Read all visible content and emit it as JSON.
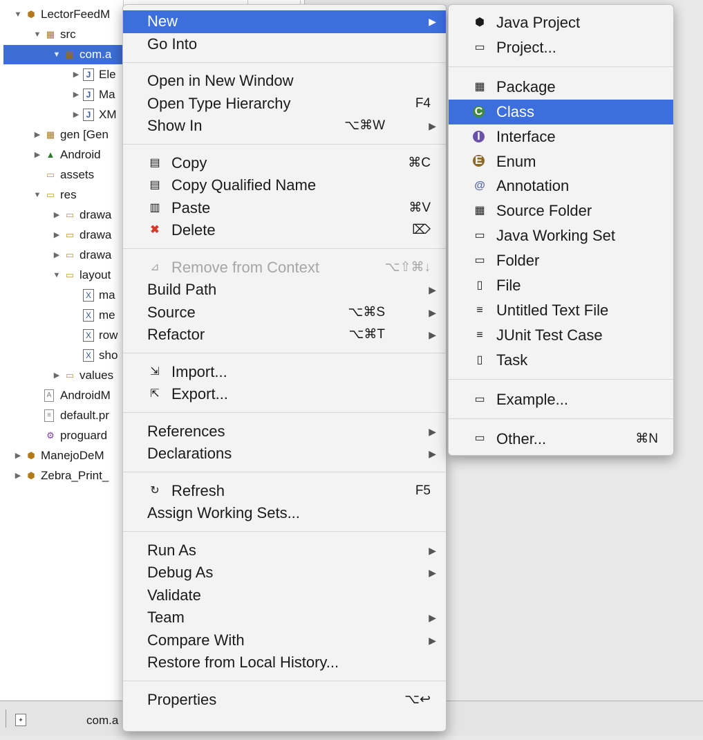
{
  "explorer": {
    "rows": [
      {
        "label": "LectorFeedM",
        "level": 0,
        "twisty": "▼",
        "icon": "project-icon",
        "glyph": "⬢"
      },
      {
        "label": "src",
        "level": 1,
        "twisty": "▼",
        "icon": "source-folder-icon",
        "glyph": "▦"
      },
      {
        "label": "com.a",
        "level": 2,
        "twisty": "▼",
        "icon": "package-icon",
        "glyph": "▦",
        "selected": true
      },
      {
        "label": "Ele",
        "level": 3,
        "twisty": "▶",
        "icon": "java-file-icon",
        "glyph": "J"
      },
      {
        "label": "Ma",
        "level": 3,
        "twisty": "▶",
        "icon": "java-file-icon",
        "glyph": "J"
      },
      {
        "label": "XM",
        "level": 3,
        "twisty": "▶",
        "icon": "java-file-icon",
        "glyph": "J"
      },
      {
        "label": "gen [Gen",
        "level": 1,
        "twisty": "▶",
        "icon": "generated-folder-icon",
        "glyph": "▦"
      },
      {
        "label": "Android",
        "level": 1,
        "twisty": "▶",
        "icon": "library-icon",
        "glyph": "▲"
      },
      {
        "label": "assets",
        "level": 1,
        "twisty": "",
        "icon": "folder-icon",
        "glyph": "▭"
      },
      {
        "label": "res",
        "level": 1,
        "twisty": "▼",
        "icon": "folder-icon",
        "glyph": "▭"
      },
      {
        "label": "drawa",
        "level": 2,
        "twisty": "▶",
        "icon": "folder-icon",
        "glyph": "▭"
      },
      {
        "label": "drawa",
        "level": 2,
        "twisty": "▶",
        "icon": "folder-icon",
        "glyph": "▭"
      },
      {
        "label": "drawa",
        "level": 2,
        "twisty": "▶",
        "icon": "folder-icon",
        "glyph": "▭"
      },
      {
        "label": "layout",
        "level": 2,
        "twisty": "▼",
        "icon": "folder-icon",
        "glyph": "▭"
      },
      {
        "label": "ma",
        "level": 3,
        "twisty": "",
        "icon": "xml-file-icon",
        "glyph": "X"
      },
      {
        "label": "me",
        "level": 3,
        "twisty": "",
        "icon": "xml-file-icon",
        "glyph": "X"
      },
      {
        "label": "row",
        "level": 3,
        "twisty": "",
        "icon": "xml-file-icon",
        "glyph": "X"
      },
      {
        "label": "sho",
        "level": 3,
        "twisty": "",
        "icon": "xml-file-icon",
        "glyph": "X"
      },
      {
        "label": "values",
        "level": 2,
        "twisty": "▶",
        "icon": "folder-icon",
        "glyph": "▭"
      },
      {
        "label": "AndroidM",
        "level": 1,
        "twisty": "",
        "icon": "manifest-file-icon",
        "glyph": "A"
      },
      {
        "label": "default.pr",
        "level": 1,
        "twisty": "",
        "icon": "file-icon",
        "glyph": "≡"
      },
      {
        "label": "proguard",
        "level": 1,
        "twisty": "",
        "icon": "gear-file-icon",
        "glyph": "⚙"
      },
      {
        "label": "ManejoDeM",
        "level": 0,
        "twisty": "▶",
        "icon": "project-icon",
        "glyph": "⬢"
      },
      {
        "label": "Zebra_Print_",
        "level": 0,
        "twisty": "▶",
        "icon": "project-icon",
        "glyph": "⬢"
      }
    ]
  },
  "context_menu": {
    "groups": [
      [
        {
          "label": "New",
          "arrow": true,
          "highlighted": true
        },
        {
          "label": "Go Into"
        }
      ],
      [
        {
          "label": "Open in New Window"
        },
        {
          "label": "Open Type Hierarchy",
          "shortcut": "F4"
        },
        {
          "label": "Show In",
          "shortcut": "⌥⌘W",
          "arrow": true
        }
      ],
      [
        {
          "label": "Copy",
          "shortcut": "⌘C",
          "icon": "copy-icon",
          "glyph": "▤"
        },
        {
          "label": "Copy Qualified Name",
          "icon": "copy-qualified-name-icon",
          "glyph": "▤"
        },
        {
          "label": "Paste",
          "shortcut": "⌘V",
          "icon": "paste-icon",
          "glyph": "▥"
        },
        {
          "label": "Delete",
          "shortcut": "⌦",
          "icon": "delete-icon",
          "glyph": "✖"
        }
      ],
      [
        {
          "label": "Remove from Context",
          "shortcut": "⌥⇧⌘↓",
          "icon": "remove-context-icon",
          "glyph": "⊿",
          "disabled": true
        },
        {
          "label": "Build Path",
          "arrow": true
        },
        {
          "label": "Source",
          "shortcut": "⌥⌘S",
          "arrow": true
        },
        {
          "label": "Refactor",
          "shortcut": "⌥⌘T",
          "arrow": true
        }
      ],
      [
        {
          "label": "Import...",
          "icon": "import-icon",
          "glyph": "⇲"
        },
        {
          "label": "Export...",
          "icon": "export-icon",
          "glyph": "⇱"
        }
      ],
      [
        {
          "label": "References",
          "arrow": true
        },
        {
          "label": "Declarations",
          "arrow": true
        }
      ],
      [
        {
          "label": "Refresh",
          "shortcut": "F5",
          "icon": "refresh-icon",
          "glyph": "↻"
        },
        {
          "label": "Assign Working Sets..."
        }
      ],
      [
        {
          "label": "Run As",
          "arrow": true
        },
        {
          "label": "Debug As",
          "arrow": true
        },
        {
          "label": "Validate"
        },
        {
          "label": "Team",
          "arrow": true
        },
        {
          "label": "Compare With",
          "arrow": true
        },
        {
          "label": "Restore from Local History..."
        }
      ],
      [
        {
          "label": "Properties",
          "shortcut": "⌥↩"
        }
      ]
    ]
  },
  "submenu": {
    "groups": [
      [
        {
          "label": "Java Project",
          "icon": "java-project-icon",
          "glyph": "⬢"
        },
        {
          "label": "Project...",
          "icon": "project-icon",
          "glyph": "▭"
        }
      ],
      [
        {
          "label": "Package",
          "icon": "package-icon",
          "glyph": "▦"
        },
        {
          "label": "Class",
          "icon": "class-icon",
          "glyph": "C",
          "highlighted": true
        },
        {
          "label": "Interface",
          "icon": "interface-icon",
          "glyph": "I"
        },
        {
          "label": "Enum",
          "icon": "enum-icon",
          "glyph": "E"
        },
        {
          "label": "Annotation",
          "icon": "annotation-icon",
          "glyph": "@"
        },
        {
          "label": "Source Folder",
          "icon": "source-folder-icon",
          "glyph": "▦"
        },
        {
          "label": "Java Working Set",
          "icon": "working-set-icon",
          "glyph": "▭"
        },
        {
          "label": "Folder",
          "icon": "folder-icon",
          "glyph": "▭"
        },
        {
          "label": "File",
          "icon": "file-icon",
          "glyph": "▯"
        },
        {
          "label": "Untitled Text File",
          "icon": "text-file-icon",
          "glyph": "≡"
        },
        {
          "label": "JUnit Test Case",
          "icon": "junit-icon",
          "glyph": "≡"
        },
        {
          "label": "Task",
          "icon": "task-icon",
          "glyph": "▯"
        }
      ],
      [
        {
          "label": "Example...",
          "icon": "example-icon",
          "glyph": "▭"
        }
      ],
      [
        {
          "label": "Other...",
          "shortcut": "⌘N",
          "icon": "other-icon",
          "glyph": "▭"
        }
      ]
    ]
  },
  "statusbar": {
    "text": "com.a"
  }
}
